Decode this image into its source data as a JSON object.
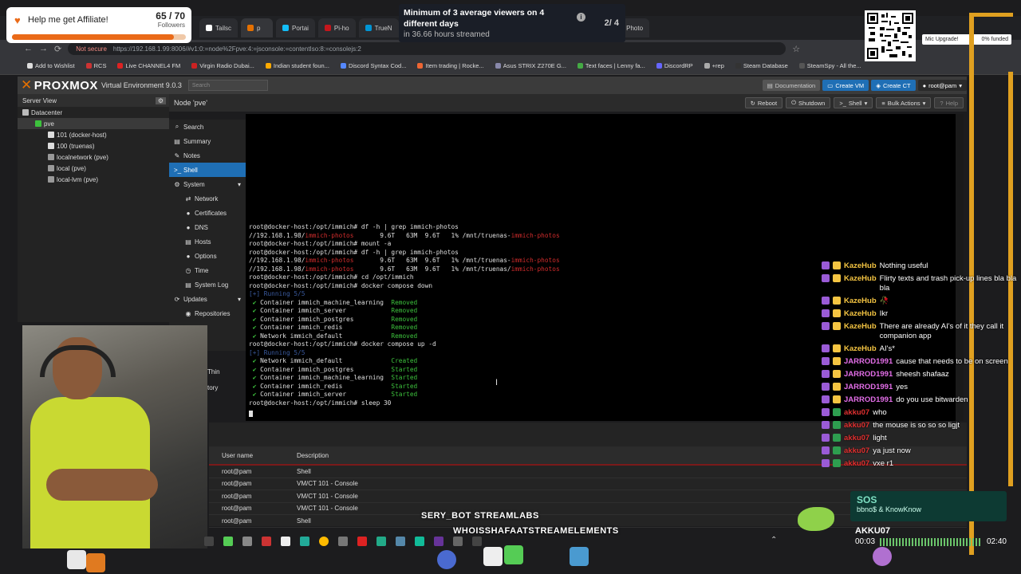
{
  "browser": {
    "tabs": [
      {
        "label": "Tailsc",
        "color": "#ffffff"
      },
      {
        "label": "p",
        "color": "#e57000"
      },
      {
        "label": "Portai",
        "color": "#13bef9"
      },
      {
        "label": "Pi-ho",
        "color": "#c4161c"
      },
      {
        "label": "TrueN",
        "color": "#0095d5"
      },
      {
        "label": "Tunne",
        "color": "#f38020"
      },
      {
        "label": "Self-H",
        "color": "#aaaaaa"
      },
      {
        "label": "Notes",
        "color": "#cccccc"
      },
      {
        "label": "awes",
        "color": "#ffffff"
      },
      {
        "label": "onez",
        "color": "#8844cc"
      },
      {
        "label": "Photo",
        "color": "#ff5555"
      }
    ],
    "not_secure": "Not secure",
    "url": "https://192.168.1.99:8006/#v1:0:=node%2Fpve:4:=jsconsole:=contentIso:8:=consolejs:2",
    "bookmarks": [
      "Add to Wishlist",
      "RCS",
      "Live CHANNEL4 FM",
      "Virgin Radio Dubai...",
      "Indian student foun...",
      "Discord Syntax Cod...",
      "Item trading | Rocke...",
      "Asus STRIX Z270E G...",
      "Text faces | Lenny fa...",
      "DiscordRP",
      "+rep",
      "Steam Database",
      "SteamSpy - All the..."
    ]
  },
  "pve": {
    "logo": "PROXMOX",
    "version": "Virtual Environment 9.0.3",
    "search_placeholder": "Search",
    "documentation": "Documentation",
    "create_vm": "Create VM",
    "create_ct": "Create CT",
    "user": "root@pam",
    "server_view": "Server View",
    "node_title": "Node 'pve'",
    "reboot": "Reboot",
    "shutdown": "Shutdown",
    "shell": "Shell",
    "bulk_actions": "Bulk Actions",
    "help": "Help",
    "tree": [
      {
        "label": "Datacenter",
        "indent": 0,
        "icon": "#bbbbbb"
      },
      {
        "label": "pve",
        "indent": 1,
        "icon": "#3dc23d"
      },
      {
        "label": "101 (docker-host)",
        "indent": 2,
        "icon": "#dddddd"
      },
      {
        "label": "100 (truenas)",
        "indent": 2,
        "icon": "#dddddd"
      },
      {
        "label": "localnetwork (pve)",
        "indent": 2,
        "icon": "#999999"
      },
      {
        "label": "local (pve)",
        "indent": 2,
        "icon": "#999999"
      },
      {
        "label": "local-lvm (pve)",
        "indent": 2,
        "icon": "#999999"
      }
    ],
    "menu": [
      {
        "label": "Search",
        "icon": "⌕",
        "sub": false,
        "selected": false
      },
      {
        "label": "Summary",
        "icon": "▤",
        "sub": false,
        "selected": false
      },
      {
        "label": "Notes",
        "icon": "✎",
        "sub": false,
        "selected": false
      },
      {
        "label": "Shell",
        "icon": ">_",
        "sub": false,
        "selected": true
      },
      {
        "label": "System",
        "icon": "⚙",
        "sub": false,
        "selected": false
      },
      {
        "label": "Network",
        "icon": "⇄",
        "sub": true,
        "selected": false
      },
      {
        "label": "Certificates",
        "icon": "●",
        "sub": true,
        "selected": false
      },
      {
        "label": "DNS",
        "icon": "●",
        "sub": true,
        "selected": false
      },
      {
        "label": "Hosts",
        "icon": "▤",
        "sub": true,
        "selected": false
      },
      {
        "label": "Options",
        "icon": "●",
        "sub": true,
        "selected": false
      },
      {
        "label": "Time",
        "icon": "◷",
        "sub": true,
        "selected": false
      },
      {
        "label": "System Log",
        "icon": "▤",
        "sub": true,
        "selected": false
      },
      {
        "label": "Updates",
        "icon": "⟳",
        "sub": false,
        "selected": false
      },
      {
        "label": "Repositories",
        "icon": "◉",
        "sub": true,
        "selected": false
      }
    ],
    "menu_partial": [
      "Thin",
      "tory"
    ]
  },
  "terminal": {
    "lines": [
      [
        {
          "t": "root@docker-host:/opt/immich# df -h | grep immich-photos",
          "c": ""
        }
      ],
      [
        {
          "t": "//192.168.1.98/",
          "c": ""
        },
        {
          "t": "immich-photos",
          "c": "red"
        },
        {
          "t": "       9.6T   63M  9.6T   1% /mnt/truenas-",
          "c": ""
        },
        {
          "t": "immich-photos",
          "c": "red"
        }
      ],
      [
        {
          "t": "root@docker-host:/opt/immich# mount -a",
          "c": ""
        }
      ],
      [
        {
          "t": "root@docker-host:/opt/immich# df -h | grep immich-photos",
          "c": ""
        }
      ],
      [
        {
          "t": "//192.168.1.98/",
          "c": ""
        },
        {
          "t": "immich-photos",
          "c": "red"
        },
        {
          "t": "       9.6T   63M  9.6T   1% /mnt/truenas-",
          "c": ""
        },
        {
          "t": "immich-photos",
          "c": "red"
        }
      ],
      [
        {
          "t": "//192.168.1.98/",
          "c": ""
        },
        {
          "t": "immich-photos",
          "c": "red"
        },
        {
          "t": "       9.6T   63M  9.6T   1% /mnt/truenas/",
          "c": ""
        },
        {
          "t": "immich-photos",
          "c": "red"
        }
      ],
      [
        {
          "t": "root@docker-host:/opt/immich# cd /opt/immich",
          "c": ""
        }
      ],
      [
        {
          "t": "root@docker-host:/opt/immich# docker compose down",
          "c": ""
        }
      ],
      [
        {
          "t": "[+] Running 5/5",
          "c": "blu"
        }
      ],
      [
        {
          "t": " ✔ ",
          "c": "chk"
        },
        {
          "t": "Container immich_machine_learning  ",
          "c": ""
        },
        {
          "t": "Removed",
          "c": "grn"
        }
      ],
      [
        {
          "t": " ✔ ",
          "c": "chk"
        },
        {
          "t": "Container immich_server            ",
          "c": ""
        },
        {
          "t": "Removed",
          "c": "grn"
        }
      ],
      [
        {
          "t": " ✔ ",
          "c": "chk"
        },
        {
          "t": "Container immich_postgres          ",
          "c": ""
        },
        {
          "t": "Removed",
          "c": "grn"
        }
      ],
      [
        {
          "t": " ✔ ",
          "c": "chk"
        },
        {
          "t": "Container immich_redis             ",
          "c": ""
        },
        {
          "t": "Removed",
          "c": "grn"
        }
      ],
      [
        {
          "t": " ✔ ",
          "c": "chk"
        },
        {
          "t": "Network immich_default             ",
          "c": ""
        },
        {
          "t": "Removed",
          "c": "grn"
        }
      ],
      [
        {
          "t": "root@docker-host:/opt/immich# docker compose up -d",
          "c": ""
        }
      ],
      [
        {
          "t": "[+] Running 5/5",
          "c": "blu"
        }
      ],
      [
        {
          "t": " ✔ ",
          "c": "chk"
        },
        {
          "t": "Network immich_default             ",
          "c": ""
        },
        {
          "t": "Created",
          "c": "grn"
        }
      ],
      [
        {
          "t": " ✔ ",
          "c": "chk"
        },
        {
          "t": "Container immich_postgres          ",
          "c": ""
        },
        {
          "t": "Started",
          "c": "grn"
        }
      ],
      [
        {
          "t": " ✔ ",
          "c": "chk"
        },
        {
          "t": "Container immich_machine_learning  ",
          "c": ""
        },
        {
          "t": "Started",
          "c": "grn"
        }
      ],
      [
        {
          "t": " ✔ ",
          "c": "chk"
        },
        {
          "t": "Container immich_redis             ",
          "c": ""
        },
        {
          "t": "Started",
          "c": "grn"
        }
      ],
      [
        {
          "t": " ✔ ",
          "c": "chk"
        },
        {
          "t": "Container immich_server            ",
          "c": ""
        },
        {
          "t": "Started",
          "c": "grn"
        }
      ],
      [
        {
          "t": "root@docker-host:/opt/immich# sleep 30",
          "c": ""
        }
      ]
    ]
  },
  "tasks": {
    "headers": [
      "User name",
      "Description"
    ],
    "rows": [
      [
        "root@pam",
        "Shell"
      ],
      [
        "root@pam",
        "VM/CT 101 - Console"
      ],
      [
        "root@pam",
        "VM/CT 101 - Console"
      ],
      [
        "root@pam",
        "VM/CT 101 - Console"
      ],
      [
        "root@pam",
        "Shell"
      ]
    ]
  },
  "overlay": {
    "affiliate_label": "Help me get Affiliate!",
    "followers_count": "65 / 70",
    "followers_label": "Followers",
    "followers_progress": 0.93,
    "viewers_goal": "Minimum of 3 average viewers on 4 different days",
    "viewers_sub": "in 36.66 hours streamed",
    "viewers_page": "2/ 4",
    "mic_upgrade": "Mic Upgrade!",
    "mic_funded": "0% funded",
    "ticker_line1": "SERY_BOT  STREAMLABS",
    "ticker_line2": "WHOISSHAFAATSTREAMELEMENTS",
    "sos_title": "SOS",
    "sos_artist": "bbno$ & KnowKnow",
    "player_name": "AKKU07",
    "time_start": "00:03",
    "time_end": "02:40",
    "brand_orange": "#ea6a18",
    "frame_color": "#e0a020"
  },
  "chat": [
    {
      "user": "KazeHub",
      "color": "#f5c542",
      "text": "Nothing useful"
    },
    {
      "user": "KazeHub",
      "color": "#f5c542",
      "text": "Flirty texts and trash pick-up lines bla bla bla"
    },
    {
      "user": "KazeHub",
      "color": "#f5c542",
      "text": "🥀"
    },
    {
      "user": "KazeHub",
      "color": "#f5c542",
      "text": "Ikr"
    },
    {
      "user": "KazeHub",
      "color": "#f5c542",
      "text": "There are already AI's of it they call it companion app"
    },
    {
      "user": "KazeHub",
      "color": "#f5c542",
      "text": "AI's*"
    },
    {
      "user": "JARROD1991",
      "color": "#e36ee8",
      "text": "cause that needs to be on screen"
    },
    {
      "user": "JARROD1991",
      "color": "#e36ee8",
      "text": "sheesh shafaaz"
    },
    {
      "user": "JARROD1991",
      "color": "#e36ee8",
      "text": "yes"
    },
    {
      "user": "JARROD1991",
      "color": "#e36ee8",
      "text": "do you use bitwarden"
    },
    {
      "user": "akku07",
      "color": "#e03030",
      "text": "who"
    },
    {
      "user": "akku07",
      "color": "#e03030",
      "text": "the mouse is so so so ligjt"
    },
    {
      "user": "akku07",
      "color": "#e03030",
      "text": "light"
    },
    {
      "user": "akku07",
      "color": "#e03030",
      "text": "ya just now"
    },
    {
      "user": "akku07",
      "color": "#e03030",
      "text": "vxe r1"
    }
  ]
}
